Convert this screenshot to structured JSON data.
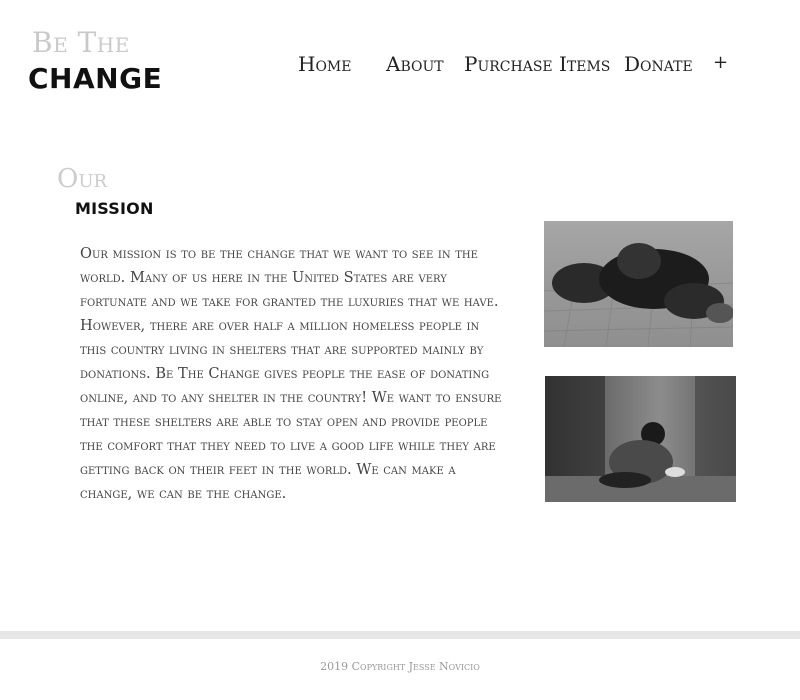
{
  "logo": {
    "top": "Be The",
    "bottom": "CHANGE"
  },
  "nav": {
    "home": "Home",
    "about": "About",
    "purchase": "Purchase Items",
    "donate": "Donate",
    "more": "+"
  },
  "mission": {
    "heading_small": "Our",
    "heading_bold": "mission",
    "body": "Our mission is to be the change that we want to see in the world. Many of us here in the United States are very fortunate and we take for granted the luxuries that we have. However, there are over half a million homeless people in this country living in shelters that are supported mainly by donations. Be The Change gives people the ease of donating online, and to any shelter in the country! We want to ensure that these shelters are able to stay open and provide people the comfort that they need to live a good life while they are getting back on their feet in the world. We can make a change, we can be the change."
  },
  "footer": {
    "copyright": "2019 Copyright Jesse Novicio"
  }
}
